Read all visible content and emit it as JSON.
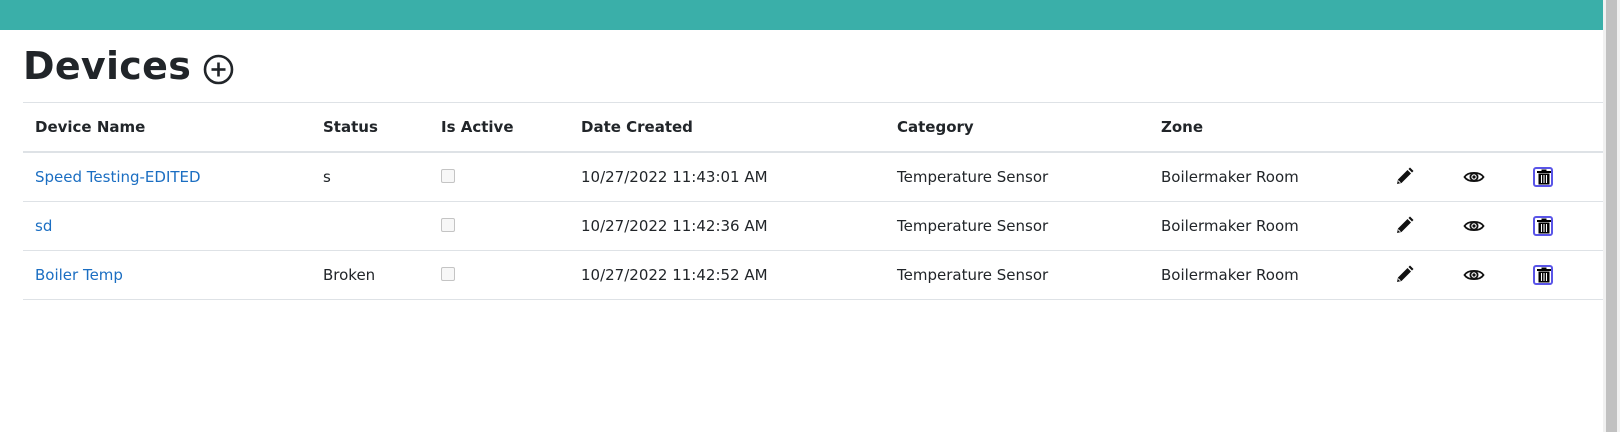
{
  "header": {
    "accent_color": "#3aafa9"
  },
  "page": {
    "title": "Devices",
    "add_icon": "plus-circle-icon"
  },
  "table": {
    "columns": [
      "Device Name",
      "Status",
      "Is Active",
      "Date Created",
      "Category",
      "Zone"
    ],
    "rows": [
      {
        "device_name": "Speed Testing-EDITED",
        "status": "s",
        "is_active": false,
        "date_created": "10/27/2022 11:43:01 AM",
        "category": "Temperature Sensor",
        "zone": "Boilermaker Room"
      },
      {
        "device_name": "sd",
        "status": "",
        "is_active": false,
        "date_created": "10/27/2022 11:42:36 AM",
        "category": "Temperature Sensor",
        "zone": "Boilermaker Room"
      },
      {
        "device_name": "Boiler Temp",
        "status": "Broken",
        "is_active": false,
        "date_created": "10/27/2022 11:42:52 AM",
        "category": "Temperature Sensor",
        "zone": "Boilermaker Room"
      }
    ],
    "row_actions": [
      "pencil-icon",
      "eye-icon",
      "trash-icon"
    ],
    "link_color": "#1b6ec2",
    "delete_border_color": "#5a55e8"
  }
}
